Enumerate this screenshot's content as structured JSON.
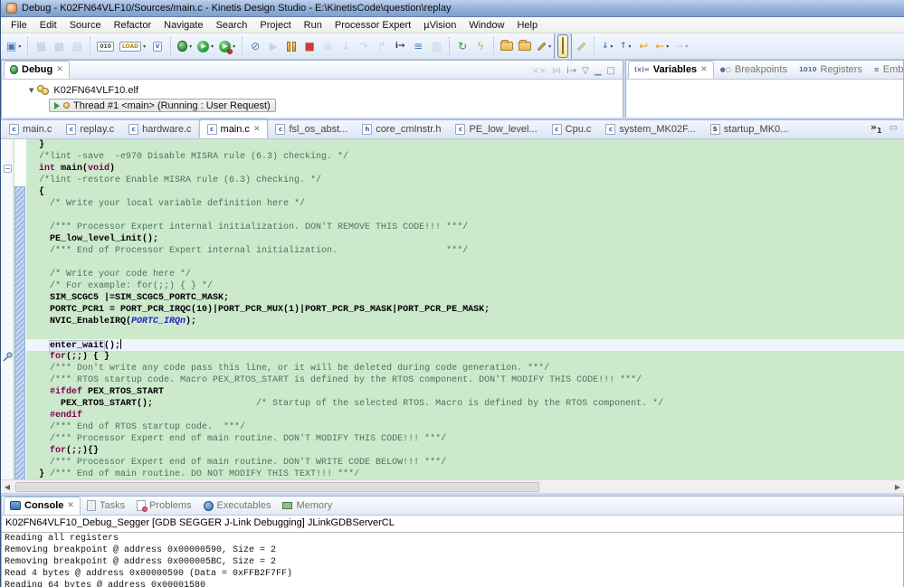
{
  "window": {
    "title": "Debug - K02FN64VLF10/Sources/main.c - Kinetis Design Studio - E:\\KinetisCode\\question\\replay",
    "menus": [
      "File",
      "Edit",
      "Source",
      "Refactor",
      "Navigate",
      "Search",
      "Project",
      "Run",
      "Processor Expert",
      "µVision",
      "Window",
      "Help"
    ]
  },
  "toolbar": {
    "items": [
      {
        "n": "new-wizard",
        "k": "g",
        "t": "▣",
        "c": "#4a79b8",
        "dd": 1
      },
      {
        "sep": 1
      },
      {
        "n": "save",
        "k": "g",
        "t": "▦",
        "c": "#9aa7b5",
        "dis": 1
      },
      {
        "n": "save-all",
        "k": "g",
        "t": "▩",
        "c": "#9aa7b5",
        "dis": 1
      },
      {
        "n": "print",
        "k": "g",
        "t": "▤",
        "c": "#9aa7b5",
        "dis": 1
      },
      {
        "sep": 1
      },
      {
        "n": "binary-utility",
        "k": "box",
        "t": "010",
        "c": "#444"
      },
      {
        "n": "flash-load",
        "k": "box",
        "t": "LOAD",
        "c": "#b8860b",
        "dd": 1
      },
      {
        "n": "uvision",
        "k": "box",
        "t": "V",
        "c": "#4a5fb0"
      },
      {
        "sep": 1
      },
      {
        "n": "debug",
        "k": "bug",
        "dd": 1
      },
      {
        "n": "run",
        "k": "run",
        "dd": 1
      },
      {
        "n": "run-configurations",
        "k": "run2",
        "dd": 1
      },
      {
        "sep": 1
      },
      {
        "n": "skip-all-breakpoints",
        "k": "g",
        "t": "⊘",
        "c": "#4a79b8"
      },
      {
        "n": "resume",
        "k": "g",
        "t": "▶",
        "c": "#a9bac9",
        "dis": 1
      },
      {
        "n": "suspend",
        "k": "pause"
      },
      {
        "n": "terminate",
        "k": "g",
        "t": "■",
        "c": "#cb3b3b"
      },
      {
        "n": "disconnect",
        "k": "g",
        "t": "⊗",
        "c": "#a9bac9",
        "dis": 1
      },
      {
        "n": "step-into",
        "k": "g",
        "t": "↓",
        "c": "#a9bac9",
        "dis": 1
      },
      {
        "n": "step-over",
        "k": "g",
        "t": "↷",
        "c": "#a9bac9",
        "dis": 1
      },
      {
        "n": "step-return",
        "k": "g",
        "t": "↱",
        "c": "#a9bac9",
        "dis": 1
      },
      {
        "n": "instruction-stepping",
        "k": "box2",
        "t": "i→",
        "c": "#333"
      },
      {
        "n": "debug-console",
        "k": "g",
        "t": "≡",
        "c": "#4a79b8"
      },
      {
        "n": "trace-control",
        "k": "g",
        "t": "▥",
        "c": "#a9bac9",
        "dis": 1
      },
      {
        "sep": 1
      },
      {
        "n": "restart",
        "k": "g",
        "t": "↻",
        "c": "#2e9e3f"
      },
      {
        "n": "flash-device",
        "k": "g",
        "t": "ϟ",
        "c": "#e3a62e"
      },
      {
        "sep": 1
      },
      {
        "n": "open-element",
        "k": "folder"
      },
      {
        "n": "open-resource",
        "k": "folder"
      },
      {
        "n": "toggle-mark-occurrences",
        "k": "pen",
        "dd": 1
      },
      {
        "n": "highlight-toggle",
        "k": "mark",
        "sel": 1
      },
      {
        "n": "pin-editor",
        "k": "pen",
        "dis": 1
      },
      {
        "sep": 1
      },
      {
        "n": "next-annotation",
        "k": "box2",
        "t": "↓",
        "c": "#4a79b8",
        "dd": 1
      },
      {
        "n": "previous-annotation",
        "k": "box2",
        "t": "↑",
        "c": "#4a79b8",
        "dd": 1
      },
      {
        "n": "last-edit-location",
        "k": "g",
        "t": "↩",
        "c": "#d9a520"
      },
      {
        "n": "back",
        "k": "g",
        "t": "←",
        "c": "#d9a520",
        "dd": 1
      },
      {
        "n": "forward",
        "k": "g",
        "t": "→",
        "c": "#b9c5d2",
        "dis": 1,
        "dd": 1
      }
    ]
  },
  "debug_panel": {
    "tab": "Debug",
    "buttons": [
      {
        "n": "remove-all-terminated",
        "t": "××",
        "dis": 1
      },
      {
        "n": "disconnect-session",
        "t": "⋈",
        "dis": 1
      },
      {
        "n": "instruction-stepping-mode",
        "t": "i→",
        "dis": 0
      },
      {
        "n": "view-menu",
        "t": "▽"
      },
      {
        "n": "minimize-view",
        "t": "▁"
      },
      {
        "n": "maximize-view",
        "t": "□"
      }
    ],
    "tree": {
      "elf": "K02FN64VLF10.elf",
      "thread": "Thread #1 <main> (Running : User Request)"
    }
  },
  "right_panel": {
    "tabs": [
      {
        "label": "Variables",
        "icon": "(x)=",
        "active": 1,
        "close": 1
      },
      {
        "label": "Breakpoints",
        "icon": "●○"
      },
      {
        "label": "Registers",
        "icon": "1010"
      },
      {
        "label": "EmbSys Regi",
        "icon": "≡"
      }
    ]
  },
  "editor": {
    "tabs": [
      {
        "label": "main.c",
        "ft": "c"
      },
      {
        "label": "replay.c",
        "ft": "c"
      },
      {
        "label": "hardware.c",
        "ft": "c"
      },
      {
        "label": "main.c",
        "ft": "c",
        "active": 1,
        "close": 1
      },
      {
        "label": "fsl_os_abst...",
        "ft": "c"
      },
      {
        "label": "core_cmInstr.h",
        "ft": "h"
      },
      {
        "label": "PE_low_level...",
        "ft": "c"
      },
      {
        "label": "Cpu.c",
        "ft": "c"
      },
      {
        "label": "system_MK02F...",
        "ft": "c"
      },
      {
        "label": "startup_MK0...",
        "ft": "S"
      }
    ],
    "overflow_count": "1",
    "code": {
      "lines": [
        {
          "s": [
            [
              "b",
              "}"
            ]
          ]
        },
        {
          "s": [
            [
              "c",
              "/*lint -save  -e970 Disable MISRA rule (6.3) checking. */"
            ]
          ]
        },
        {
          "fold": 1,
          "s": [
            [
              "k",
              "int"
            ],
            [
              "b",
              " main("
            ],
            [
              "k",
              "void"
            ],
            [
              "b",
              ")"
            ]
          ]
        },
        {
          "s": [
            [
              "c",
              "/*lint -restore Enable MISRA rule (6.3) checking. */"
            ]
          ]
        },
        {
          "s": [
            [
              "b",
              "{"
            ]
          ]
        },
        {
          "s": [
            [
              "c",
              "  /* Write your local variable definition here */"
            ]
          ]
        },
        {
          "s": []
        },
        {
          "s": [
            [
              "c",
              "  /*** Processor Expert internal initialization. DON'T REMOVE THIS CODE!!! ***/"
            ]
          ]
        },
        {
          "s": [
            [
              "b",
              "  PE_low_level_init();"
            ]
          ]
        },
        {
          "s": [
            [
              "c",
              "  /*** End of Processor Expert internal initialization.                    ***/"
            ]
          ]
        },
        {
          "s": []
        },
        {
          "s": [
            [
              "c",
              "  /* Write your code here */"
            ]
          ]
        },
        {
          "s": [
            [
              "c",
              "  /* For example: for(;;) { } */"
            ]
          ]
        },
        {
          "s": [
            [
              "b",
              "  SIM_SCGC5 |=SIM_SCGC5_PORTC_MASK;"
            ]
          ]
        },
        {
          "s": [
            [
              "b",
              "  PORTC_PCR1 = PORT_PCR_IRQC(10)|PORT_PCR_MUX(1)|PORT_PCR_PS_MASK|PORT_PCR_PE_MASK;"
            ]
          ]
        },
        {
          "s": [
            [
              "b",
              "  NVIC_EnableIRQ("
            ],
            [
              "e",
              "PORTC_IRQn"
            ],
            [
              "b",
              ");"
            ]
          ]
        },
        {
          "s": []
        },
        {
          "hl": 1,
          "cursor": 1,
          "s": [
            [
              "b",
              "  "
            ],
            [
              "o",
              "enter_wait"
            ],
            [
              "b",
              "();"
            ]
          ]
        },
        {
          "marker": 1,
          "s": [
            [
              "b",
              "  "
            ],
            [
              "k",
              "for"
            ],
            [
              "b",
              "(;;) { }"
            ]
          ]
        },
        {
          "s": [
            [
              "c",
              "  /*** Don't write any code pass this line, or it will be deleted during code generation. ***/"
            ]
          ]
        },
        {
          "s": [
            [
              "c",
              "  /*** RTOS startup code. Macro PEX_RTOS_START is defined by the RTOS component. DON'T MODIFY THIS CODE!!! ***/"
            ]
          ]
        },
        {
          "s": [
            [
              "b",
              "  "
            ],
            [
              "k",
              "#ifdef"
            ],
            [
              "b",
              " PEX_RTOS_START"
            ]
          ]
        },
        {
          "s": [
            [
              "b",
              "    PEX_RTOS_START();"
            ],
            [
              "c",
              "                   /* Startup of the selected RTOS. Macro is defined by the RTOS component. */"
            ]
          ]
        },
        {
          "s": [
            [
              "b",
              "  "
            ],
            [
              "k",
              "#endif"
            ]
          ]
        },
        {
          "s": [
            [
              "c",
              "  /*** End of RTOS startup code.  ***/"
            ]
          ]
        },
        {
          "s": [
            [
              "c",
              "  /*** Processor Expert end of main routine. DON'T MODIFY THIS CODE!!! ***/"
            ]
          ]
        },
        {
          "s": [
            [
              "b",
              "  "
            ],
            [
              "k",
              "for"
            ],
            [
              "b",
              "(;;){}"
            ]
          ]
        },
        {
          "s": [
            [
              "c",
              "  /*** Processor Expert end of main routine. DON'T WRITE CODE BELOW!!! ***/"
            ]
          ]
        },
        {
          "s": [
            [
              "b",
              "} "
            ],
            [
              "c",
              "/*** End of main routine. DO NOT MODIFY THIS TEXT!!! ***/"
            ]
          ]
        }
      ]
    }
  },
  "console": {
    "tabs": [
      {
        "label": "Console",
        "kind": "console",
        "active": 1,
        "close": 1
      },
      {
        "label": "Tasks",
        "kind": "tasks"
      },
      {
        "label": "Problems",
        "kind": "problems"
      },
      {
        "label": "Executables",
        "kind": "exec"
      },
      {
        "label": "Memory",
        "kind": "memory"
      }
    ],
    "title": "K02FN64VLF10_Debug_Segger [GDB SEGGER J-Link Debugging] JLinkGDBServerCL",
    "output": [
      "Reading all registers",
      "Removing breakpoint @ address 0x00000590, Size = 2",
      "Removing breakpoint @ address 0x000005BC, Size = 2",
      "Read 4 bytes @ address 0x00000590 (Data = 0xFFB2F7FF)",
      "Reading 64 bytes @ address 0x00001580"
    ]
  },
  "colors": {
    "editor_bg": "#cde9cc",
    "current_line_bg": "#eef5fd",
    "comment": "#46735f",
    "keyword": "#7f0055",
    "enum_ref": "#2525c4",
    "run_green": "#2e9e3f",
    "stop_red": "#cb3b3b",
    "pause_gold": "#e3a62e"
  }
}
